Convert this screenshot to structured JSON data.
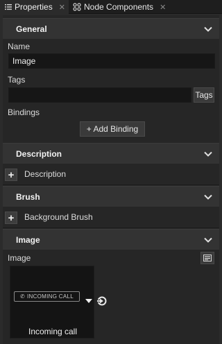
{
  "tabs": [
    {
      "label": "Properties",
      "icon": "list-icon",
      "active": true
    },
    {
      "label": "Node Components",
      "icon": "components-icon",
      "active": false
    }
  ],
  "sections": {
    "general": {
      "title": "General",
      "name_label": "Name",
      "name_value": "Image",
      "tags_label": "Tags",
      "tags_value": "",
      "tags_button": "Tags",
      "bindings_label": "Bindings",
      "add_binding_button": "+ Add Binding"
    },
    "description": {
      "title": "Description",
      "row_label": "Description"
    },
    "brush": {
      "title": "Brush",
      "row_label": "Background Brush"
    },
    "image": {
      "title": "Image",
      "image_label": "Image",
      "badge_text": "INCOMING CALL",
      "thumb_caption": "Incoming call"
    }
  },
  "colors": {
    "background": "#2b2b2b",
    "section_header": "#333333",
    "input": "#161616"
  }
}
